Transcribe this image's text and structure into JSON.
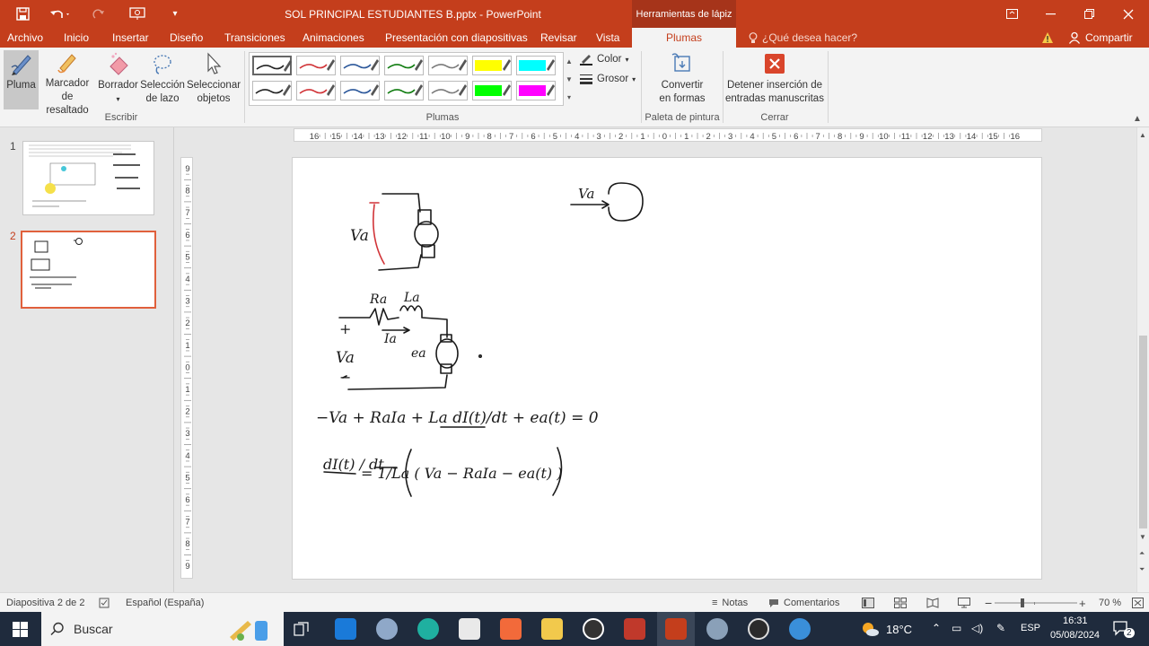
{
  "titlebar": {
    "document_title": "SOL PRINCIPAL ESTUDIANTES B.pptx  -  PowerPoint",
    "tools_label": "Herramientas de lápiz",
    "icons": [
      "save-icon",
      "undo-icon",
      "redo-icon",
      "slideshow-from-start-icon",
      "customize-qat-icon"
    ],
    "window_controls": [
      "ribbon-display-icon",
      "minimize-icon",
      "restore-icon",
      "close-icon"
    ]
  },
  "tabs": [
    "Archivo",
    "Inicio",
    "Insertar",
    "Diseño",
    "Transiciones",
    "Animaciones",
    "Presentación con diapositivas",
    "Revisar",
    "Vista",
    "Plumas"
  ],
  "active_tab": "Plumas",
  "tell_me": "¿Qué desea hacer?",
  "share": "Compartir",
  "ribbon": {
    "escribir": {
      "label": "Escribir",
      "pluma": "Pluma",
      "marcador_1": "Marcador",
      "marcador_2": "de resaltado",
      "borrador": "Borrador",
      "seleccion_1": "Selección",
      "seleccion_2": "de lazo",
      "seleccionar_1": "Seleccionar",
      "seleccionar_2": "objetos"
    },
    "plumas": {
      "label": "Plumas",
      "color": "Color",
      "grosor": "Grosor",
      "pens_row1": [
        "#222222",
        "#d13438",
        "#2b579a",
        "#107c10",
        "#7a7a7a",
        "#ffff00",
        "#00ffff"
      ],
      "pens_row2": [
        "#222222",
        "#d13438",
        "#2b579a",
        "#107c10",
        "#7a7a7a",
        "#00ff00",
        "#ff00ff"
      ]
    },
    "paleta": {
      "label": "Paleta de pintura",
      "convertir_1": "Convertir",
      "convertir_2": "en formas"
    },
    "cerrar": {
      "label": "Cerrar",
      "detener_1": "Detener inserción de",
      "detener_2": "entradas manuscritas"
    }
  },
  "slides": [
    {
      "number": "1",
      "active": false
    },
    {
      "number": "2",
      "active": true
    }
  ],
  "rulers": {
    "horizontal": [
      "16",
      "15",
      "14",
      "13",
      "12",
      "11",
      "10",
      "9",
      "8",
      "7",
      "6",
      "5",
      "4",
      "3",
      "2",
      "1",
      "0",
      "1",
      "2",
      "3",
      "4",
      "5",
      "6",
      "7",
      "8",
      "9",
      "10",
      "11",
      "12",
      "13",
      "14",
      "15",
      "16"
    ],
    "vertical": [
      "9",
      "8",
      "7",
      "6",
      "5",
      "4",
      "3",
      "2",
      "1",
      "0",
      "1",
      "2",
      "3",
      "4",
      "5",
      "6",
      "7",
      "8",
      "9"
    ]
  },
  "ink": {
    "va1": "Va",
    "va2": "Va",
    "ra": "Ra",
    "la": "La",
    "ia": "Ia",
    "ea": "ea",
    "va3": "Va",
    "plus": "+",
    "minus": "−",
    "eq1": "−Va + RaIa + La dI(t)/dt + ea(t) = 0",
    "eq2_lhs": "dI(t) / dt",
    "eq2_rhs": "= 1/La ( Va − RaIa − ea(t) )"
  },
  "statusbar": {
    "slide_info": "Diapositiva 2 de 2",
    "language": "Español (España)",
    "notes": "Notas",
    "comments": "Comentarios",
    "zoom": "70 %"
  },
  "taskbar": {
    "search": "Buscar",
    "weather": "18°C",
    "lang": "ESP",
    "time": "16:31",
    "date": "05/08/2024",
    "notifications": "2"
  }
}
